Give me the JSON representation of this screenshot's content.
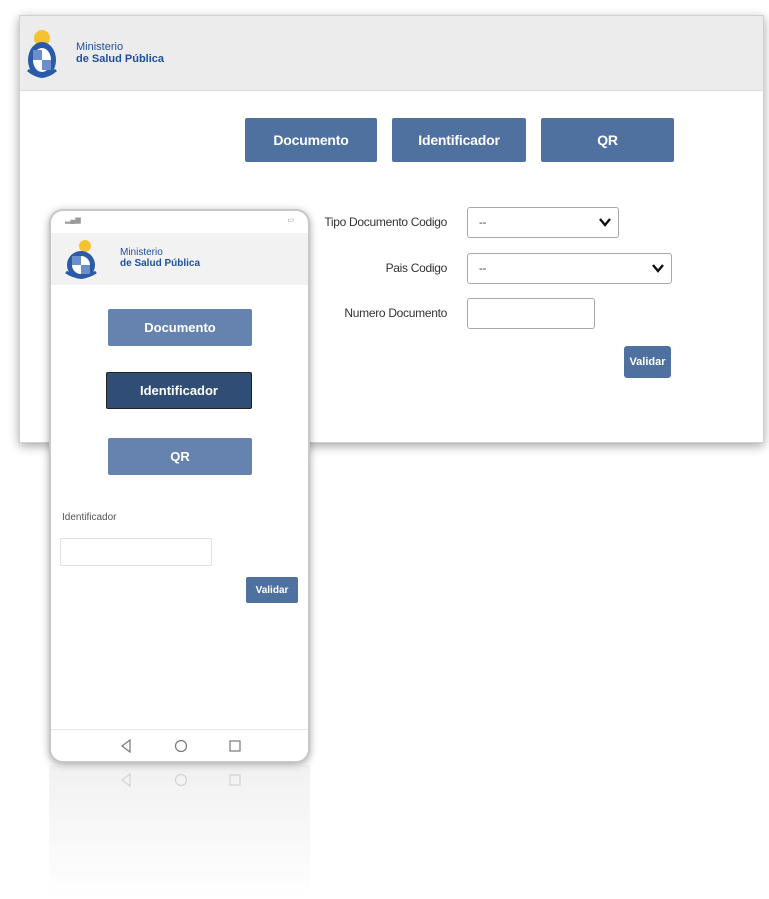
{
  "brand": {
    "line1": "Ministerio",
    "line2": "de Salud Pública"
  },
  "desktop": {
    "tabs": [
      "Documento",
      "Identificador",
      "QR"
    ],
    "form": {
      "tipo_label": "Tipo Documento Codigo",
      "tipo_value": "--",
      "pais_label": "Pais Codigo",
      "pais_value": "--",
      "numero_label": "Numero Documento",
      "numero_value": ""
    },
    "validar_label": "Validar"
  },
  "phone": {
    "tabs": [
      "Documento",
      "Identificador",
      "QR"
    ],
    "active_tab": "Identificador",
    "identificador_label": "Identificador",
    "identificador_value": "",
    "validar_label": "Validar"
  },
  "colors": {
    "primary": "#4f71a0",
    "active": "#2f4d75",
    "brand_text": "#1e4f9e"
  }
}
